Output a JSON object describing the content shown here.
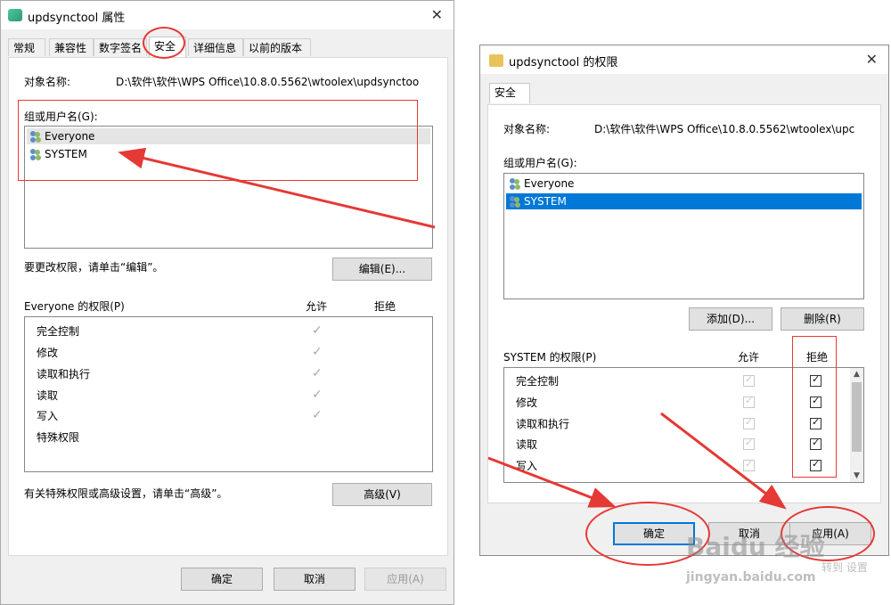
{
  "left_window": {
    "title": "updsynctool 属性",
    "close": "✕",
    "tabs": [
      "常规",
      "兼容性",
      "数字签名",
      "安全",
      "详细信息",
      "以前的版本"
    ],
    "object_label": "对象名称:",
    "object_value": "D:\\软件\\软件\\WPS Office\\10.8.0.5562\\wtoolex\\updsynctoo",
    "group_label": "组或用户名(G):",
    "users": [
      "Everyone",
      "SYSTEM"
    ],
    "edit_hint": "要更改权限，请单击“编辑”。",
    "edit_button": "编辑(E)...",
    "perm_header": "Everyone 的权限(P)",
    "allow_label": "允许",
    "deny_label": "拒绝",
    "permissions": [
      {
        "name": "完全控制",
        "allow": true,
        "deny": false
      },
      {
        "name": "修改",
        "allow": true,
        "deny": false
      },
      {
        "name": "读取和执行",
        "allow": true,
        "deny": false
      },
      {
        "name": "读取",
        "allow": true,
        "deny": false
      },
      {
        "name": "写入",
        "allow": true,
        "deny": false
      },
      {
        "name": "特殊权限",
        "allow": false,
        "deny": false
      }
    ],
    "advanced_hint": "有关特殊权限或高级设置，请单击“高级”。",
    "advanced_button": "高级(V)",
    "ok_button": "确定",
    "cancel_button": "取消",
    "apply_button": "应用(A)"
  },
  "right_window": {
    "title": "updsynctool 的权限",
    "close": "✕",
    "tab": "安全",
    "object_label": "对象名称:",
    "object_value": "D:\\软件\\软件\\WPS Office\\10.8.0.5562\\wtoolex\\upc",
    "group_label": "组或用户名(G):",
    "users": [
      "Everyone",
      "SYSTEM"
    ],
    "selected_user": "SYSTEM",
    "add_button": "添加(D)...",
    "remove_button": "删除(R)",
    "perm_header": "SYSTEM 的权限(P)",
    "allow_label": "允许",
    "deny_label": "拒绝",
    "permissions": [
      {
        "name": "完全控制",
        "allow": true,
        "deny": true
      },
      {
        "name": "修改",
        "allow": true,
        "deny": true
      },
      {
        "name": "读取和执行",
        "allow": true,
        "deny": true
      },
      {
        "name": "读取",
        "allow": true,
        "deny": true
      },
      {
        "name": "写入",
        "allow": true,
        "deny": true
      }
    ],
    "ok_button": "确定",
    "cancel_button": "取消",
    "apply_button": "应用(A)"
  },
  "watermark": {
    "brand": "Baidu 经验",
    "url": "jingyan.baidu.com",
    "extra": "转到 设置"
  },
  "colors": {
    "annotation_red": "#e53935",
    "selection_blue": "#0078d7"
  }
}
